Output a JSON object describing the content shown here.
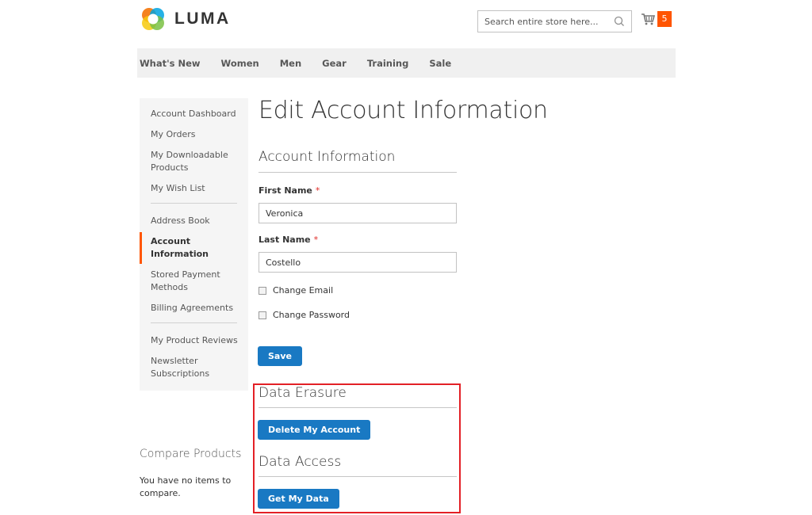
{
  "header": {
    "logo_text": "LUMA",
    "search_placeholder": "Search entire store here...",
    "cart_count": "5"
  },
  "nav": {
    "items": [
      "What's New",
      "Women",
      "Men",
      "Gear",
      "Training",
      "Sale"
    ]
  },
  "sidebar": {
    "groups": [
      [
        "Account Dashboard",
        "My Orders",
        "My Downloadable Products",
        "My Wish List"
      ],
      [
        "Address Book",
        "Account Information",
        "Stored Payment Methods",
        "Billing Agreements"
      ],
      [
        "My Product Reviews",
        "Newsletter Subscriptions"
      ]
    ],
    "active": "Account Information"
  },
  "compare": {
    "title": "Compare Products",
    "text": "You have no items to compare."
  },
  "main": {
    "page_title": "Edit Account Information",
    "account_info_title": "Account Information",
    "first_name_label": "First Name",
    "first_name_value": "Veronica",
    "last_name_label": "Last Name",
    "last_name_value": "Costello",
    "required_mark": "*",
    "change_email_label": "Change Email",
    "change_password_label": "Change Password",
    "save_label": "Save",
    "data_erasure_title": "Data Erasure",
    "delete_account_label": "Delete My Account",
    "data_access_title": "Data Access",
    "get_data_label": "Get My Data"
  },
  "colors": {
    "accent": "#ff5501",
    "button": "#1979c3",
    "highlight": "#e32026"
  },
  "icons": [
    "logo-icon",
    "search-icon",
    "cart-icon"
  ]
}
